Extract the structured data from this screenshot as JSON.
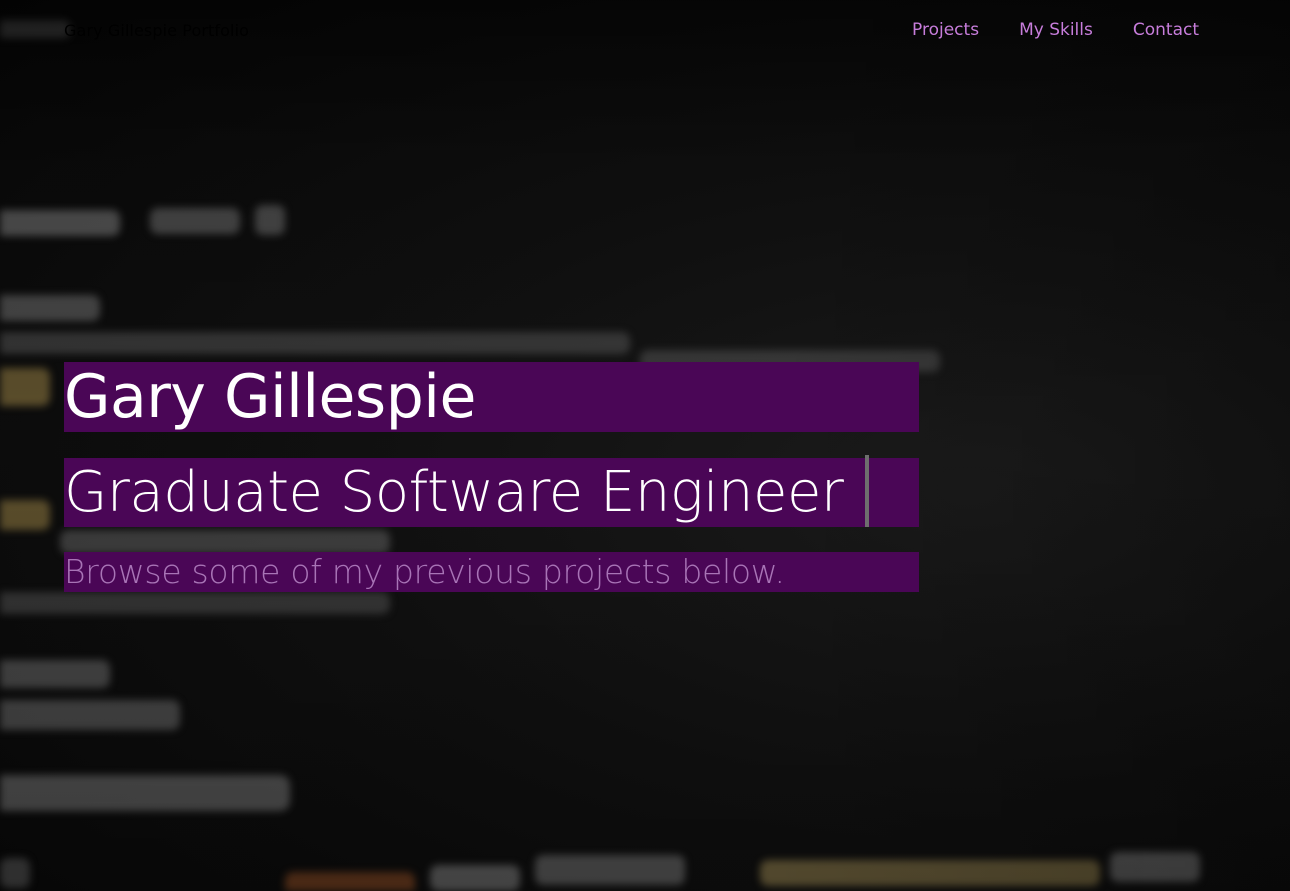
{
  "navbar": {
    "brand": "Gary Gillespie Portfolio",
    "links": [
      {
        "label": "Projects"
      },
      {
        "label": "My Skills"
      },
      {
        "label": "Contact"
      }
    ]
  },
  "hero": {
    "name": "Gary Gillespie",
    "role": "Graduate Software Engineer",
    "subtitle": "Browse some of my previous projects below."
  },
  "colors": {
    "highlight": "#4a0656",
    "nav_link": "#c77ddb",
    "heading_text": "#ffffff",
    "subtitle_text": "#a874b6",
    "brand_text": "#000000"
  }
}
